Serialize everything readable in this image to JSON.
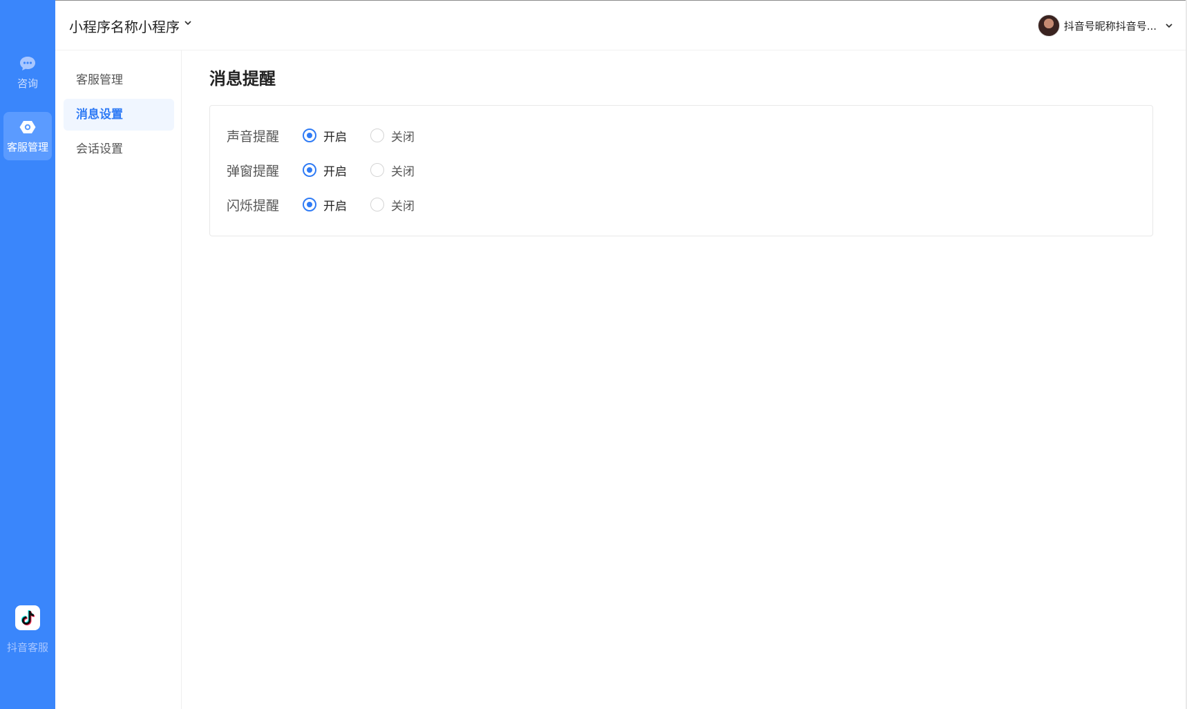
{
  "rail": {
    "consult_label": "咨询",
    "service_label": "客服管理",
    "douyin_label": "抖音客服"
  },
  "topbar": {
    "app_name": "小程序名称小程序",
    "user_name": "抖音号昵称抖音号..."
  },
  "subnav": {
    "items": [
      {
        "label": "客服管理"
      },
      {
        "label": "消息设置"
      },
      {
        "label": "会话设置"
      }
    ]
  },
  "main": {
    "title": "消息提醒",
    "settings": [
      {
        "label": "声音提醒",
        "on_label": "开启",
        "off_label": "关闭",
        "selected": "on"
      },
      {
        "label": "弹窗提醒",
        "on_label": "开启",
        "off_label": "关闭",
        "selected": "on"
      },
      {
        "label": "闪烁提醒",
        "on_label": "开启",
        "off_label": "关闭",
        "selected": "on"
      }
    ]
  },
  "colors": {
    "rail_bg": "#3a86fb",
    "accent": "#2f7bf5"
  }
}
